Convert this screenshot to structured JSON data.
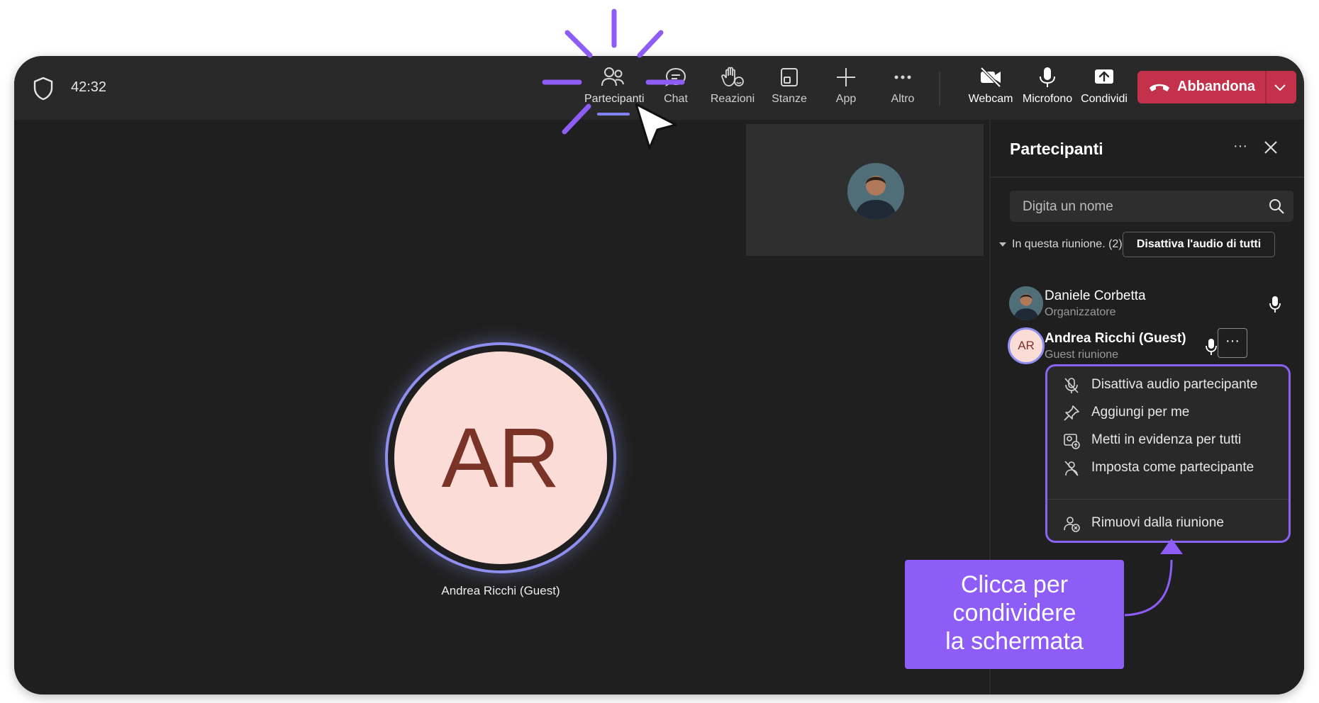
{
  "meeting": {
    "timer": "42:32"
  },
  "toolbar": {
    "participants_label": "Partecipanti",
    "chat_label": "Chat",
    "reactions_label": "Reazioni",
    "rooms_label": "Stanze",
    "apps_label": "App",
    "more_label": "Altro",
    "camera_label": "Webcam",
    "mic_label": "Microfono",
    "share_label": "Condividi",
    "leave_label": "Abbandona"
  },
  "stage": {
    "main_initials": "AR",
    "main_name": "Andrea Ricchi (Guest)"
  },
  "panel": {
    "title": "Partecipanti",
    "search_placeholder": "Digita un nome",
    "section_label": "In questa riunione. (2)",
    "mute_all_label": "Disattiva l'audio di tutti",
    "participants": [
      {
        "name": "Daniele Corbetta",
        "role": "Organizzatore"
      },
      {
        "name": "Andrea Ricchi (Guest)",
        "role": "Guest riunione",
        "initials": "AR"
      }
    ]
  },
  "context_menu": {
    "items": [
      {
        "label": "Disattiva audio partecipante",
        "icon": "mic-off-icon"
      },
      {
        "label": "Aggiungi per me",
        "icon": "pin-icon"
      },
      {
        "label": "Metti in evidenza per tutti",
        "icon": "spotlight-icon"
      },
      {
        "label": "Imposta come partecipante",
        "icon": "attendee-icon"
      },
      {
        "label": "Rimuovi dalla riunione",
        "icon": "remove-person-icon"
      }
    ]
  },
  "callout": {
    "text": "Clicca per condividere la schermata"
  },
  "colors": {
    "accent": "#8e5cf6",
    "leave": "#c4314b",
    "avatar_bg": "#fbdcd7",
    "avatar_text": "#7a3327"
  }
}
